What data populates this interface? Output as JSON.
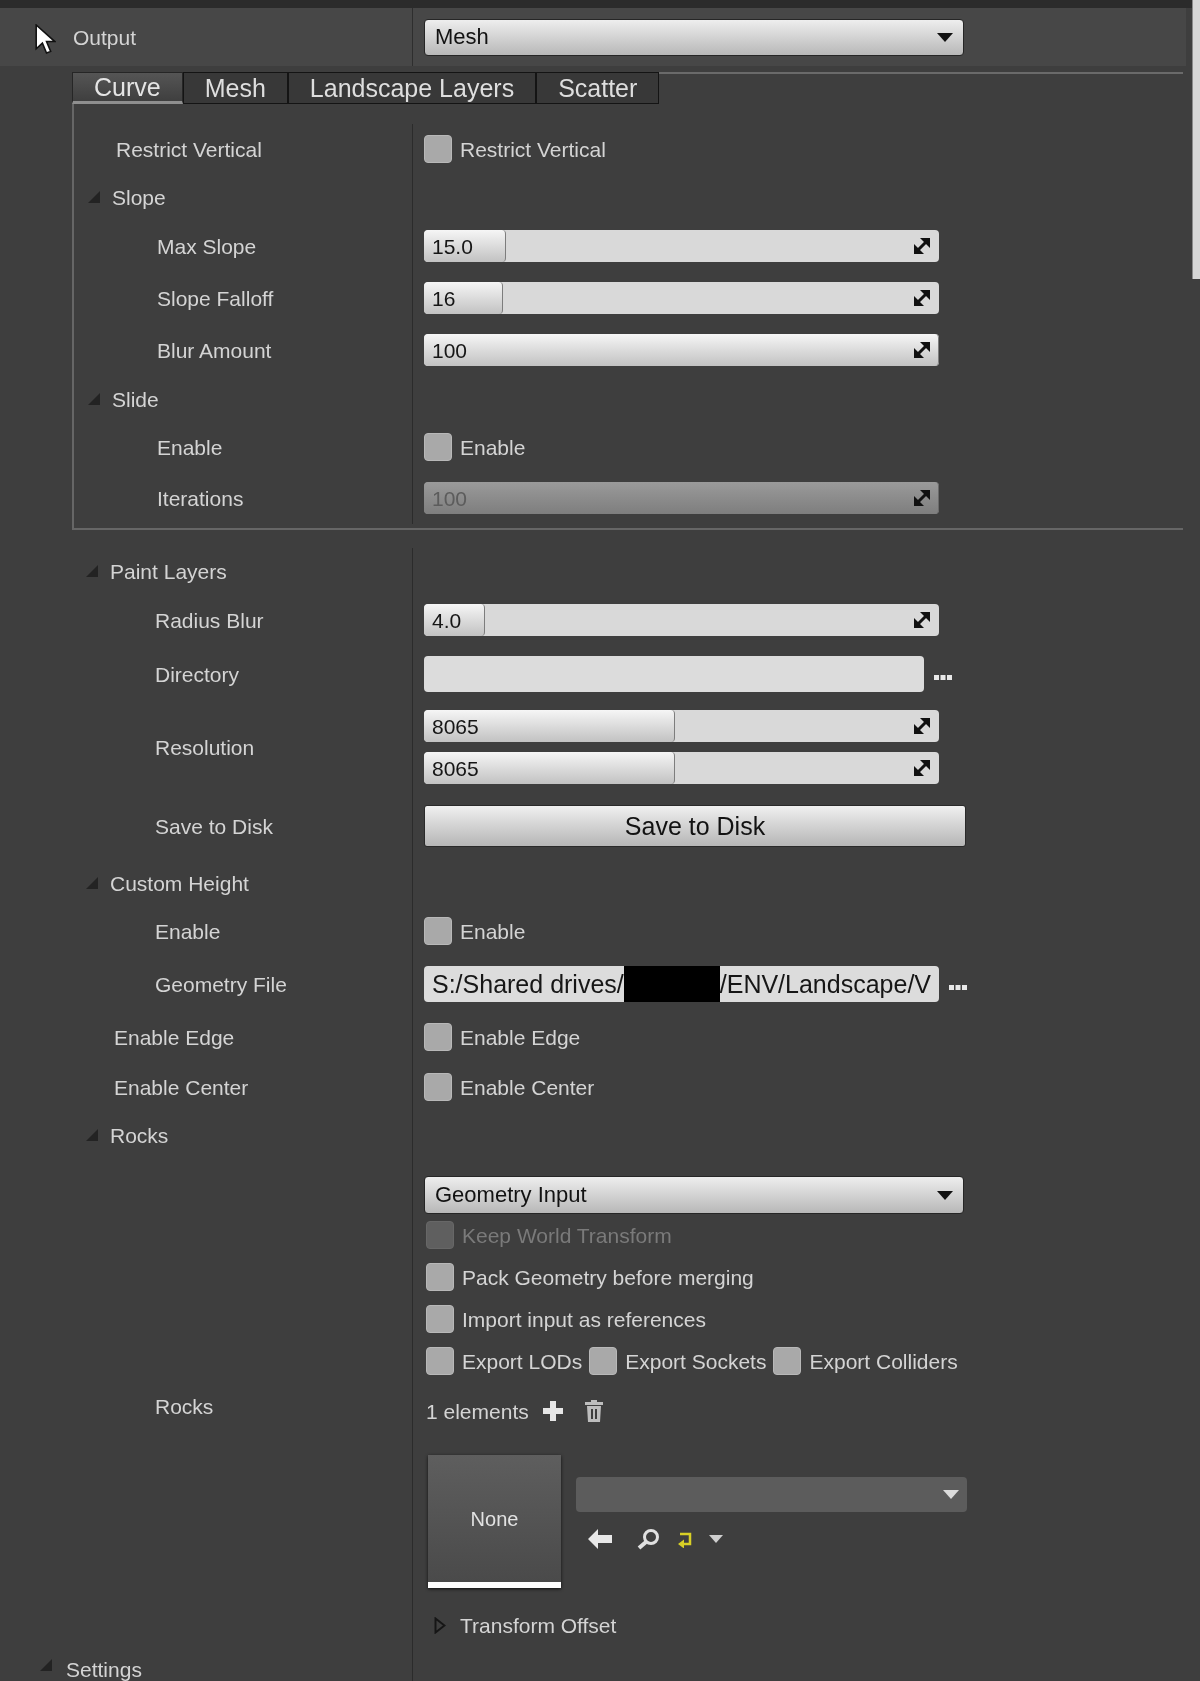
{
  "output": {
    "label": "Output",
    "value": "Mesh"
  },
  "tabs": [
    {
      "label": "Curve",
      "selected": true
    },
    {
      "label": "Mesh",
      "selected": false
    },
    {
      "label": "Landscape Layers",
      "selected": false
    },
    {
      "label": "Scatter",
      "selected": false
    }
  ],
  "tab_panel": {
    "rows": [
      {
        "kind": "checkbox",
        "label": "Restrict Vertical",
        "text": "Restrict Vertical",
        "checked": false
      },
      {
        "kind": "group",
        "label": "Slope",
        "expanded": true,
        "children": [
          {
            "kind": "slider",
            "label": "Max Slope",
            "value": "15.0",
            "level": 0.16,
            "disabled": false
          },
          {
            "kind": "slider",
            "label": "Slope Falloff",
            "value": "16",
            "level": 0.153,
            "disabled": false
          },
          {
            "kind": "slider",
            "label": "Blur Amount",
            "value": "100",
            "level": 1,
            "disabled": false
          }
        ]
      },
      {
        "kind": "group",
        "label": "Slide",
        "expanded": true,
        "children": [
          {
            "kind": "checkbox",
            "label": "Enable",
            "text": "Enable",
            "checked": false
          },
          {
            "kind": "slider",
            "label": "Iterations",
            "value": "100",
            "level": 1,
            "disabled": true
          }
        ]
      }
    ]
  },
  "rows": [
    {
      "kind": "group",
      "label": "Paint Layers",
      "expanded": true,
      "children": [
        {
          "kind": "slider",
          "label": "Radius Blur",
          "value": "4.0",
          "level": 0.118,
          "disabled": false
        },
        {
          "kind": "path",
          "label": "Directory"
        },
        {
          "kind": "multi_slider",
          "label": "Resolution",
          "sliders": [
            {
              "value": "8065",
              "level": 0.487,
              "disabled": false
            },
            {
              "value": "8065",
              "level": 0.487,
              "disabled": false
            }
          ]
        },
        {
          "kind": "button",
          "label": "Save to Disk",
          "button": "Save to Disk"
        }
      ]
    },
    {
      "kind": "group",
      "label": "Custom Height",
      "expanded": true,
      "children": [
        {
          "kind": "checkbox",
          "label": "Enable",
          "text": "Enable",
          "checked": false
        },
        {
          "kind": "path",
          "label": "Geometry File",
          "value_parts": [
            {
              "kind": "text",
              "text": "S:/Shared drives/"
            },
            {
              "kind": "redacted"
            },
            {
              "kind": "text",
              "text": "/ENV/Landscape/V"
            }
          ]
        }
      ]
    },
    {
      "kind": "checkbox",
      "label": "Enable Edge",
      "text": "Enable Edge",
      "checked": false
    },
    {
      "kind": "checkbox",
      "label": "Enable Center",
      "text": "Enable Center",
      "checked": false
    },
    {
      "kind": "group",
      "label": "Rocks",
      "expanded": true,
      "children": [
        {
          "kind": "geometry_input",
          "label": "Rocks",
          "input_type": "Geometry Input",
          "options": [
            {
              "label": "Keep World Transform",
              "checked": false,
              "disabled": true
            },
            {
              "label": "Pack Geometry before merging",
              "checked": false,
              "disabled": false
            },
            {
              "label": "Import input as references",
              "checked": false,
              "disabled": false
            }
          ],
          "export_options": [
            {
              "label": "Export LODs",
              "checked": false
            },
            {
              "label": "Export Sockets",
              "checked": false
            },
            {
              "label": "Export Colliders",
              "checked": false
            }
          ],
          "elements_count": "1 elements",
          "elements": [
            {
              "thumbnail": "None"
            }
          ],
          "transform_offset": {
            "label": "Transform Offset",
            "expanded": false
          }
        }
      ]
    }
  ],
  "settings": {
    "label": "Settings",
    "expanded": true
  }
}
